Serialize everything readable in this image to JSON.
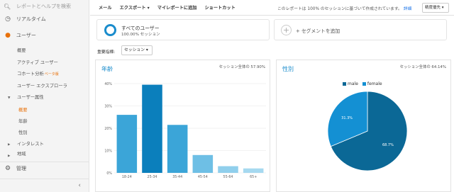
{
  "sidebar": {
    "search_placeholder": "レポートとヘルプを検索",
    "realtime_label": "リアルタイム",
    "users_label": "ユーザー",
    "sub_items": {
      "overview": "概要",
      "active_users": "アクティブ ユーザー",
      "cohort": "コホート分析",
      "cohort_badge": "ベータ版",
      "explorer": "ユーザー エクスプローラ",
      "attributes": "ユーザー属性",
      "attr_overview": "概要",
      "age": "年齢",
      "gender": "性別",
      "interests": "インタレスト",
      "geo": "地域"
    },
    "admin_label": "管理",
    "collapse_glyph": "‹"
  },
  "toolbar": {
    "items": [
      "メール",
      "エクスポート ▾",
      "マイレポートに追加",
      "ショートカット"
    ],
    "note": "このレポートは 100% のセッションに基づいて作成されています。",
    "note_link": "詳細",
    "select_value": "精度優先"
  },
  "segments": {
    "all_users_title": "すべてのユーザー",
    "all_users_sub": "100.00% セッション",
    "add_segment": "+ セグメントを追加"
  },
  "metric": {
    "label": "重要指標:",
    "value": "セッション"
  },
  "colors": {
    "accent": "#1a8ccc",
    "active_orange": "#e8710a",
    "male": "#0b6896",
    "female": "#1490d3"
  },
  "age_panel": {
    "title": "年齢",
    "meta": "セッション全体の 57.90%"
  },
  "gender_panel": {
    "title": "性別",
    "meta": "セッション全体の 64.14%"
  },
  "chart_data": [
    {
      "type": "bar",
      "categories": [
        "18-24",
        "25-34",
        "35-44",
        "45-54",
        "55-64",
        "65+"
      ],
      "values": [
        26,
        39.5,
        21.5,
        8,
        3,
        2
      ],
      "yticks": [
        "0%",
        "10%",
        "20%",
        "30%",
        "40%"
      ],
      "ylim": [
        0,
        40
      ],
      "grid": true
    },
    {
      "type": "pie",
      "labels": [
        "male",
        "female"
      ],
      "values": [
        68.7,
        31.3
      ],
      "data_labels": [
        "68.7%",
        "31.3%"
      ],
      "legend": "top-center"
    }
  ]
}
